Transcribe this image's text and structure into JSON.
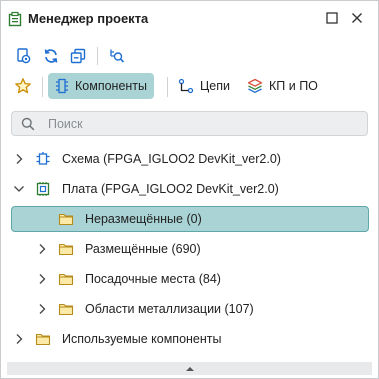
{
  "header": {
    "title": "Менеджер проекта",
    "icons": [
      "project-manager-icon",
      "maximize-icon",
      "close-icon"
    ]
  },
  "toolbar": {
    "buttons": [
      "view-mode-icon",
      "refresh-icon",
      "collapse-all-icon",
      "find-in-tree-icon"
    ]
  },
  "tabs": [
    {
      "label": "Компоненты",
      "icon": "component-icon",
      "active": true
    },
    {
      "label": "Цепи",
      "icon": "nets-icon",
      "active": false
    },
    {
      "label": "КП и ПО",
      "icon": "layers-icon",
      "active": false
    }
  ],
  "search": {
    "placeholder": "Поиск",
    "value": ""
  },
  "tree": [
    {
      "label": "Схема (FPGA_IGLOO2 DevKit_ver2.0)",
      "expanded": false,
      "icon": "schematic-icon"
    },
    {
      "label": "Плата (FPGA_IGLOO2 DevKit_ver2.0)",
      "expanded": true,
      "icon": "board-icon"
    },
    {
      "label": "Неразмещённые (0)",
      "selected": true,
      "icon": "folder-icon"
    },
    {
      "label": "Размещённые (690)",
      "icon": "folder-icon"
    },
    {
      "label": "Посадочные места (84)",
      "icon": "folder-icon"
    },
    {
      "label": "Области металлизации (107)",
      "icon": "folder-icon"
    },
    {
      "label": "Используемые компоненты",
      "icon": "folder-icon"
    }
  ],
  "colors": {
    "accent": "#a9d3d4",
    "accent_border": "#5fa7a9",
    "folder": "#e8c15a",
    "icon_blue": "#1f6fd1"
  }
}
